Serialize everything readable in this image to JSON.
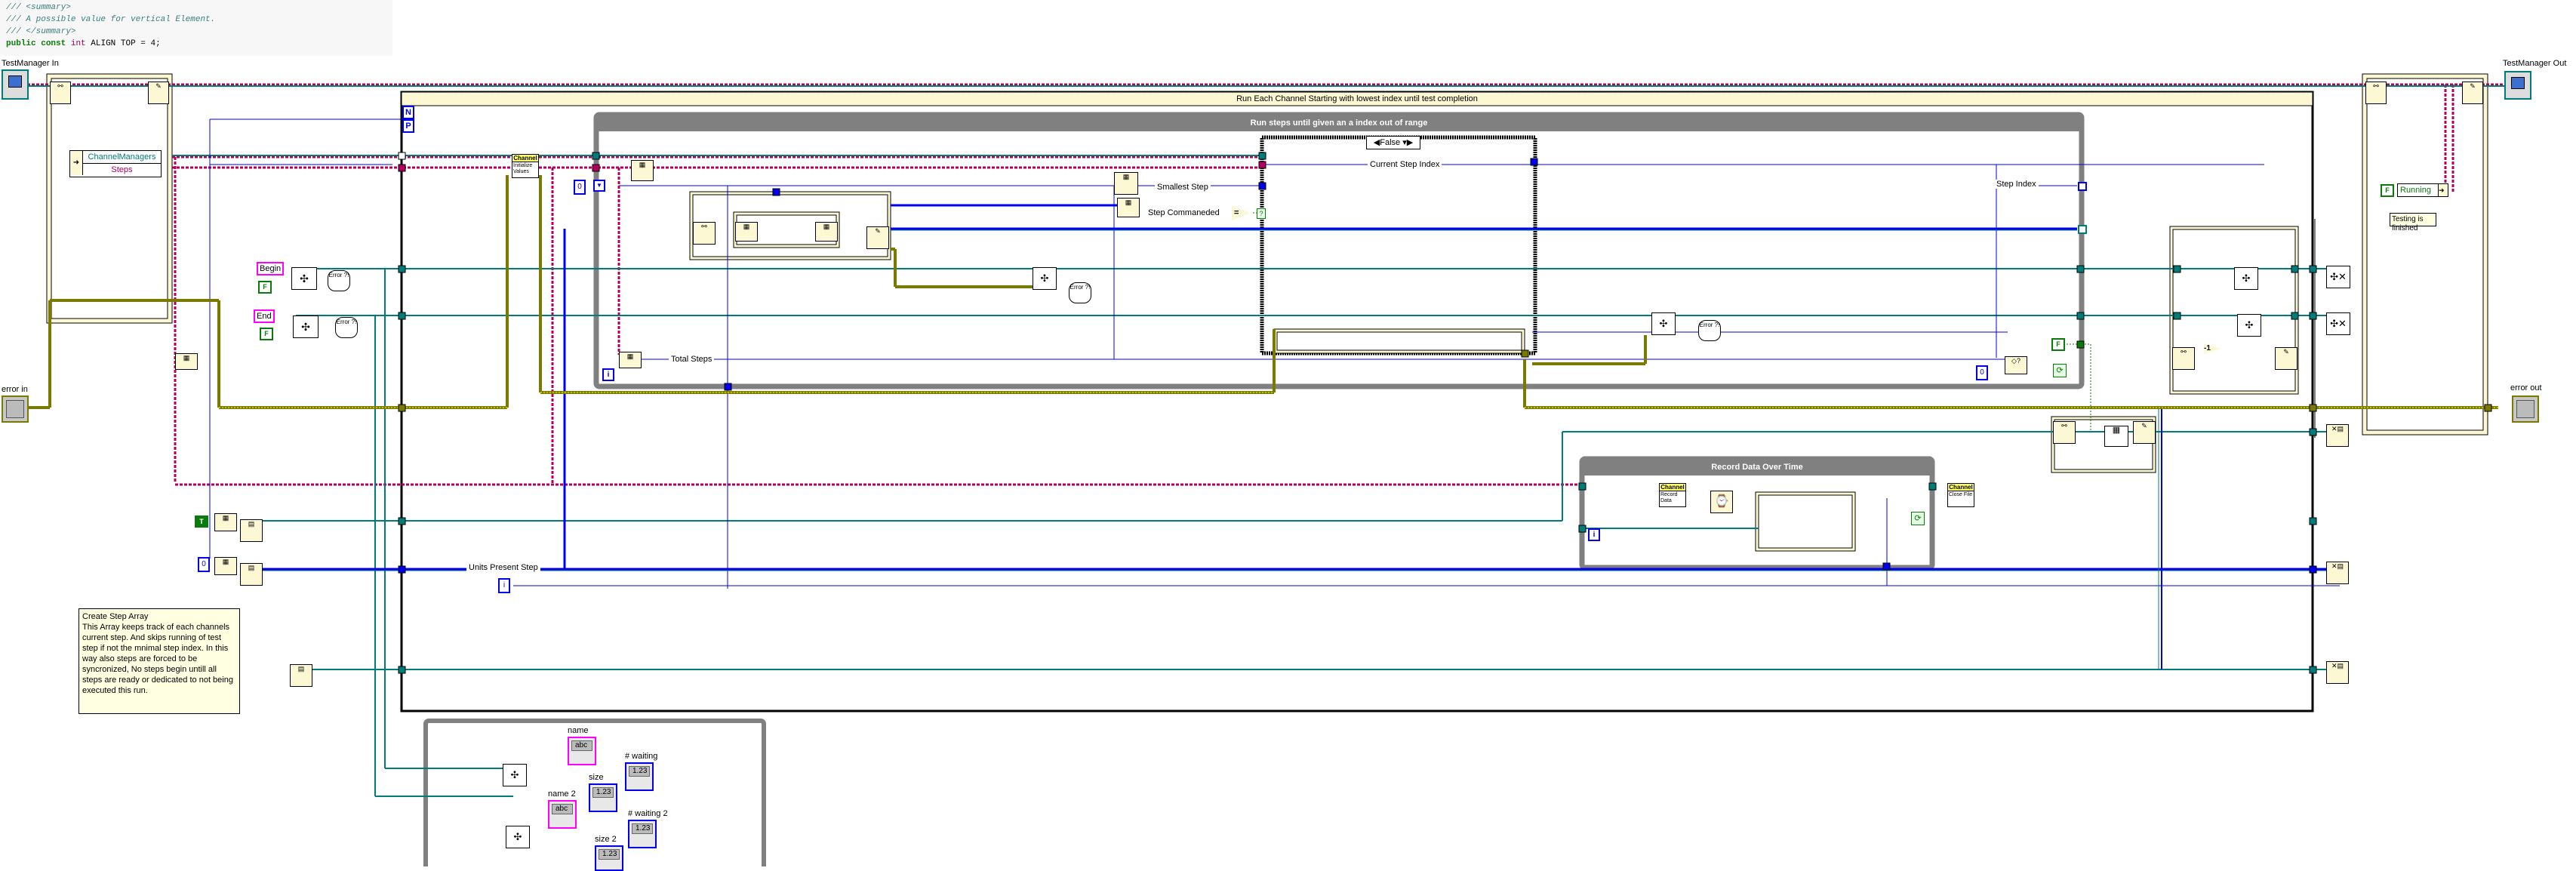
{
  "code_snippet": {
    "line1": "/// <summary>",
    "line2": "/// A possible value for vertical Element.",
    "line3": "/// </summary>",
    "line4_kw1": "public",
    "line4_kw2": "const",
    "line4_type": "int",
    "line4_rest": "ALIGN TOP = 4;"
  },
  "terminals": {
    "testmanager_in": "TestManager In",
    "testmanager_out": "TestManager Out",
    "error_in": "error in",
    "error_out": "error out"
  },
  "unbundle": {
    "field1": "ChannelManagers",
    "field2": "Steps"
  },
  "frames": {
    "outer_loop_title": "Run Each Channel Starting with lowest index until test completion",
    "inner_loop_title": "Run steps until given an a index out of range",
    "case_selector": "False",
    "record_loop_title": "Record Data Over Time"
  },
  "loop_terminals": {
    "count": "N",
    "parallel": "P",
    "iteration": "i"
  },
  "wire_labels": {
    "current_step_index": "Current Step Index",
    "smallest_step": "Smallest Step",
    "step_commanded": "Step Commaneded",
    "step_index": "Step Index",
    "total_steps": "Total Steps",
    "units_present_step": "Units Present Step"
  },
  "constants": {
    "begin": "Begin",
    "end": "End",
    "false": "F",
    "true": "T",
    "zero": "0",
    "minus_one": "-1"
  },
  "subvis": {
    "channel_initialize_tag": "Channel",
    "channel_initialize_body": "Initialize Values",
    "channel_record_tag": "Channel",
    "channel_record_body": "Record Data",
    "channel_close_tag": "Channel",
    "channel_close_body": "Close File"
  },
  "bundle": {
    "running": "Running"
  },
  "notes": {
    "testing_finished": "Testing is finished",
    "step_array_title": "Create Step Array",
    "step_array_body": "This Array keeps track of each channels current step. And skips running of test step if not the mnimal step index. In this way also steps are forced to be syncronized, No steps begin untill all steps are ready or dedicated to not being executed this run."
  },
  "status_panel": {
    "name": "name",
    "name_value": "abc",
    "waiting": "# waiting",
    "waiting_value": "1.23",
    "size": "size",
    "size_value": "1.23",
    "name2": "name 2",
    "name2_value": "abc",
    "waiting2": "# waiting 2",
    "waiting2_value": "1.23",
    "size2": "size 2",
    "size2_value": "1.23",
    "type_i32": "I32",
    "type_abc": "abc"
  },
  "icons": {
    "error_dialog": "Error ?!",
    "equal": "=",
    "question": "?"
  },
  "colors": {
    "wire_class": "#b0005e",
    "wire_numeric": "#0000ee",
    "wire_queue": "#007c7c",
    "wire_error": "#7a7a00",
    "wire_boolean": "#0a7a0a",
    "frame_gray": "#808080",
    "frame_yellow": "#fbf8d3"
  }
}
